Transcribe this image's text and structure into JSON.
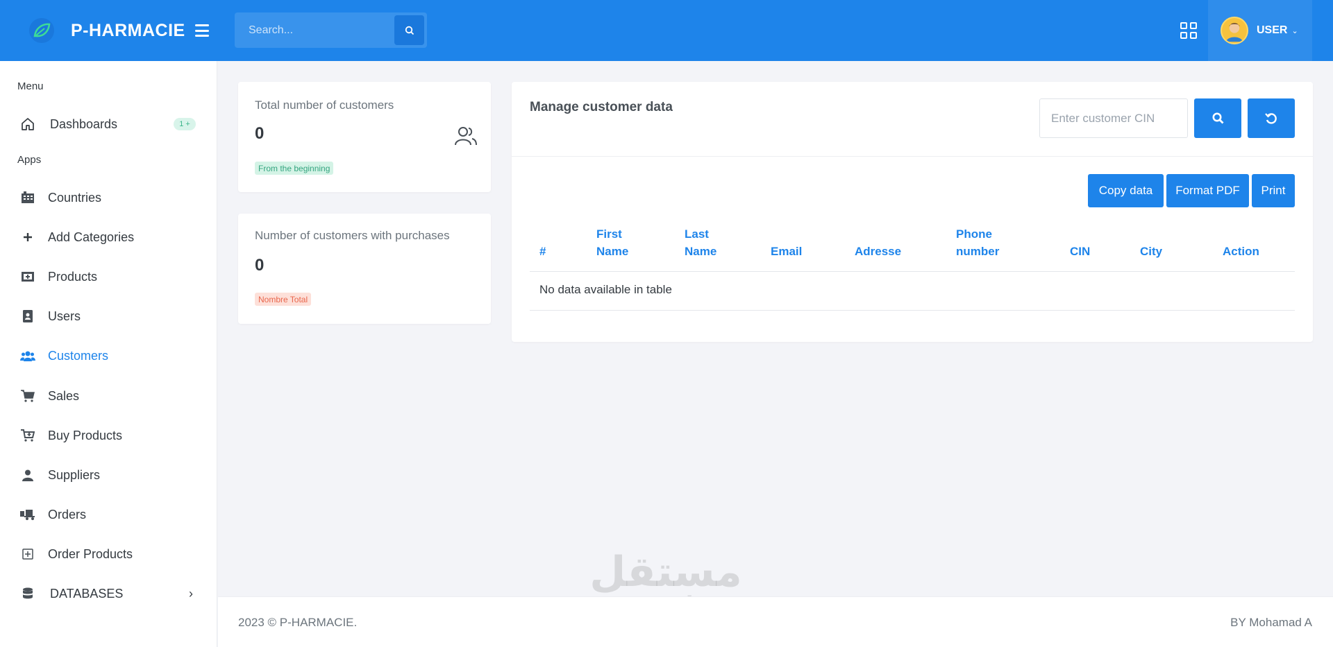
{
  "app": {
    "brand": "P-HARMACIE",
    "brand_color": "#1e84ea"
  },
  "topbar": {
    "search_placeholder": "Search...",
    "user_name": "USER"
  },
  "sidebar": {
    "section_menu": "Menu",
    "section_apps": "Apps",
    "dashboard": {
      "label": "Dashboards",
      "badge": "1 +"
    },
    "items": [
      {
        "label": "Countries",
        "icon": "building-icon"
      },
      {
        "label": "Add Categories",
        "icon": "plus-icon"
      },
      {
        "label": "Products",
        "icon": "products-icon"
      },
      {
        "label": "Users",
        "icon": "user-badge-icon"
      },
      {
        "label": "Customers",
        "icon": "users-icon"
      },
      {
        "label": "Sales",
        "icon": "cart-icon"
      },
      {
        "label": "Buy Products",
        "icon": "cart-plus-icon"
      },
      {
        "label": "Suppliers",
        "icon": "person-icon"
      },
      {
        "label": "Orders",
        "icon": "truck-icon"
      },
      {
        "label": "Order Products",
        "icon": "plus-square-icon"
      }
    ],
    "databases": "DATABASES"
  },
  "stats": [
    {
      "label": "Total number of customers",
      "value": "0",
      "pill": "From the beginning"
    },
    {
      "label": "Number of customers with purchases",
      "value": "0",
      "pill": "Nombre Total"
    }
  ],
  "manage": {
    "title": "Manage customer data",
    "cin_placeholder": "Enter customer CIN",
    "buttons": {
      "copy": "Copy data",
      "pdf": "Format PDF",
      "print": "Print"
    },
    "columns": [
      {
        "line1": "#",
        "line2": ""
      },
      {
        "line1": "First",
        "line2": "Name"
      },
      {
        "line1": "Last",
        "line2": "Name"
      },
      {
        "line1": "Email",
        "line2": ""
      },
      {
        "line1": "Adresse",
        "line2": ""
      },
      {
        "line1": "Phone",
        "line2": "number"
      },
      {
        "line1": "CIN",
        "line2": ""
      },
      {
        "line1": "City",
        "line2": ""
      },
      {
        "line1": "Action",
        "line2": ""
      }
    ],
    "empty_text": "No data available in table"
  },
  "footer": {
    "left": "2023 © P-HARMACIE.",
    "right": "BY Mohamad A"
  },
  "watermark": {
    "arabic": "مستقل",
    "latin": "mostaql.com"
  }
}
